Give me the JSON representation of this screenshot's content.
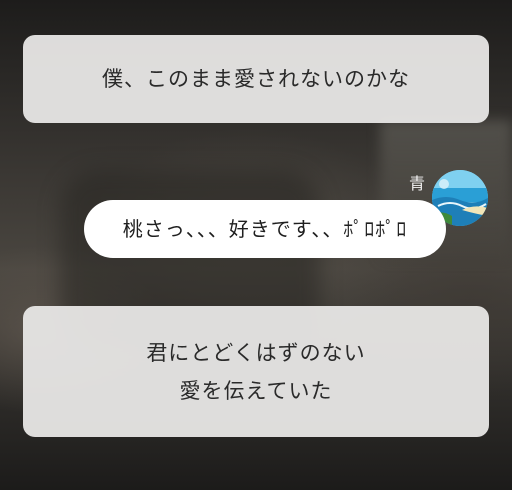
{
  "background": {
    "description_colors": [
      "#2b2a28",
      "#4a4640",
      "#1c1b1a"
    ]
  },
  "card_top": {
    "text": "僕、このまま愛されないのかな"
  },
  "message": {
    "sender_name": "青",
    "text": "桃さっ、、、好きです、、ﾎﾟﾛﾎﾟﾛ",
    "avatar_icon": "beach-landscape-avatar"
  },
  "card_bottom": {
    "line1": "君にとどくはずのない",
    "line2": "愛を伝えていた"
  },
  "colors": {
    "card": "#e8e7e6",
    "bubble": "#ffffff",
    "text": "#2a2a2a",
    "name": "#f2f2f2"
  }
}
